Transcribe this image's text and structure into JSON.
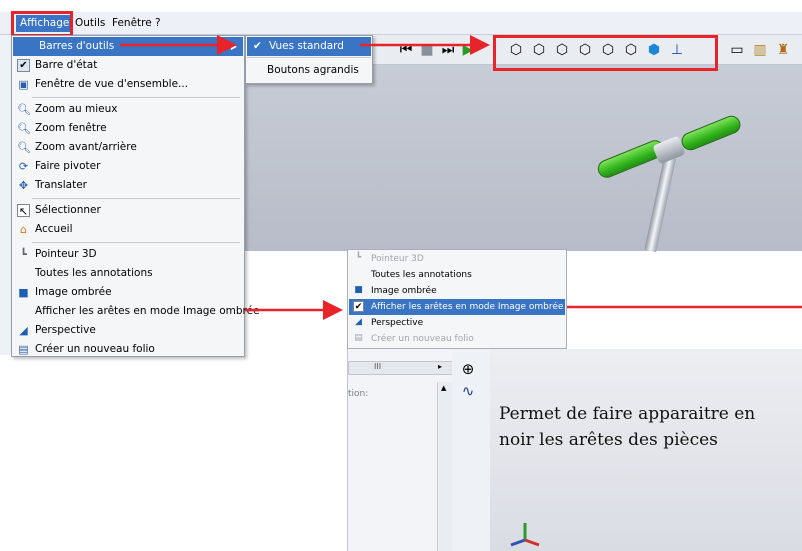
{
  "menubar": {
    "items": [
      {
        "label": "Affichage",
        "active": true
      },
      {
        "label": "Outils"
      },
      {
        "label": "Fenêtre"
      },
      {
        "label": "?"
      }
    ]
  },
  "menu": {
    "items": [
      {
        "label": "Barres d'outils",
        "icon": "none",
        "highlighted": true,
        "submenu": true
      },
      {
        "label": "Barre d'état",
        "icon": "checkmark-icon"
      },
      {
        "label": "Fenêtre de vue d'ensemble...",
        "icon": "overview-window-icon"
      },
      {
        "label": "Zoom au mieux",
        "icon": "zoom-fit-icon"
      },
      {
        "label": "Zoom fenêtre",
        "icon": "zoom-window-icon"
      },
      {
        "label": "Zoom avant/arrière",
        "icon": "zoom-in-out-icon"
      },
      {
        "label": "Faire pivoter",
        "icon": "rotate-icon"
      },
      {
        "label": "Translater",
        "icon": "pan-icon"
      },
      {
        "label": "Sélectionner",
        "icon": "select-cursor-icon"
      },
      {
        "label": "Accueil",
        "icon": "home-icon"
      },
      {
        "label": "Pointeur 3D",
        "icon": "pointer-3d-icon"
      },
      {
        "label": "Toutes les annotations",
        "icon": "none"
      },
      {
        "label": "Image ombrée",
        "icon": "shaded-image-icon"
      },
      {
        "label": "Afficher les arêtes en mode Image ombrée",
        "icon": "none"
      },
      {
        "label": "Perspective",
        "icon": "perspective-icon"
      },
      {
        "label": "Créer un nouveau folio",
        "icon": "new-sheet-icon"
      }
    ]
  },
  "submenu": {
    "items": [
      {
        "label": "Vues standard",
        "checked": true,
        "highlighted": true
      },
      {
        "label": "Boutons agrandis",
        "checked": false
      }
    ]
  },
  "inset_menu": {
    "items": [
      {
        "label": "Pointeur 3D",
        "dim": true
      },
      {
        "label": "Toutes les annotations"
      },
      {
        "label": "Image ombrée"
      },
      {
        "label": "Afficher les arêtes en mode Image ombrée",
        "checked": true,
        "highlighted": true
      },
      {
        "label": "Perspective"
      },
      {
        "label": "Créer un nouveau folio",
        "dim": true
      }
    ]
  },
  "lower_panel": {
    "scroll_marker": "III",
    "field_label": "tion:"
  },
  "caption": {
    "line1": "Permet de faire apparaitre en",
    "line2": "noir les arêtes des pièces"
  },
  "colors": {
    "highlight_blue": "#3a74c4",
    "annotation_red": "#e8232a",
    "grip_green": "#31b51c"
  }
}
